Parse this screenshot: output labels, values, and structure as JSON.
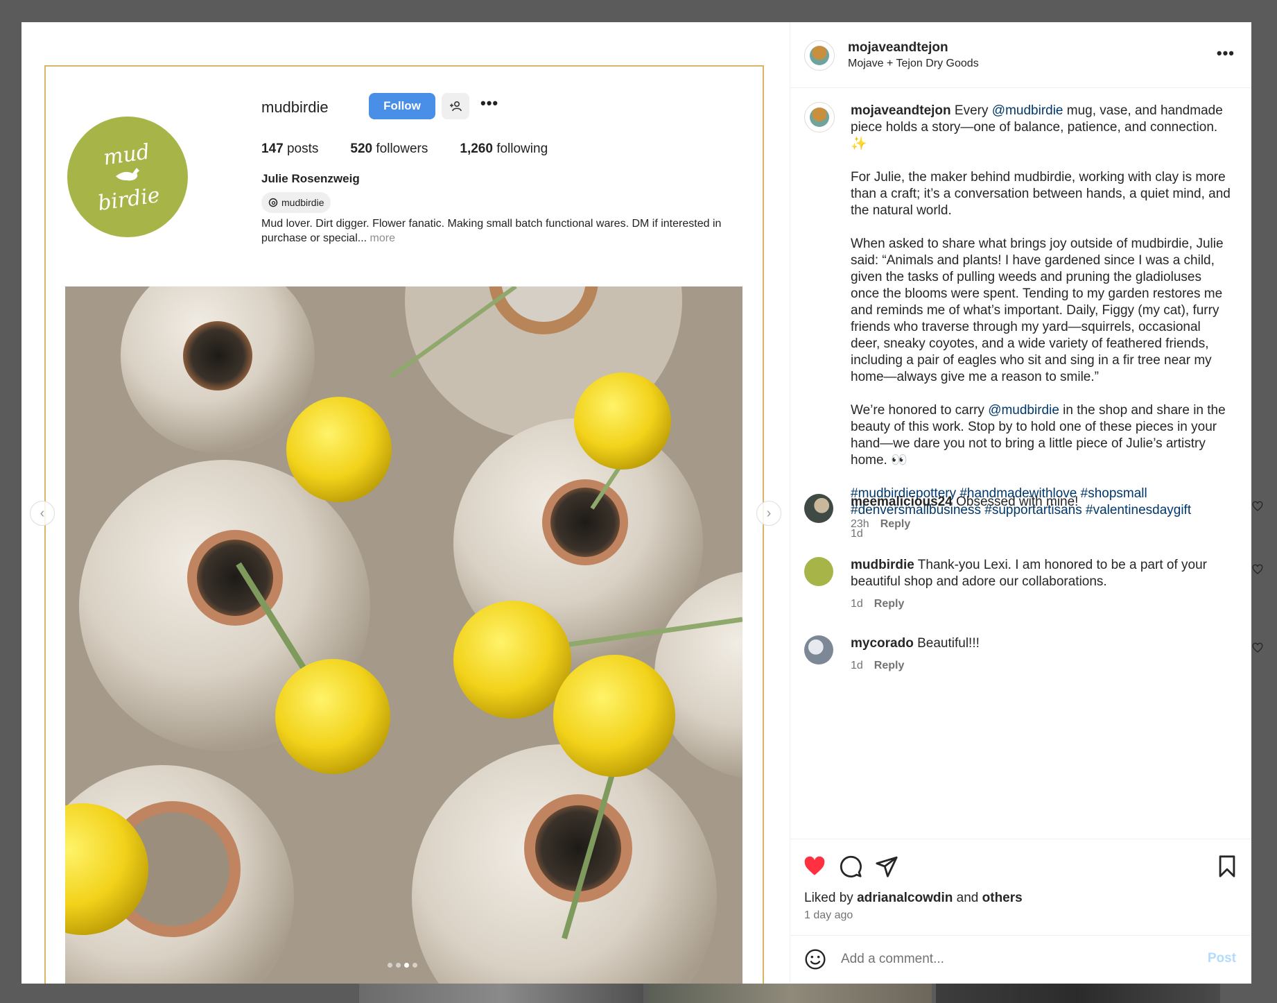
{
  "colors": {
    "accent": "#0095f6",
    "link": "#00376b",
    "heart": "#ff3040",
    "muted": "#737373",
    "post_disabled": "#b3dbff",
    "profile_green": "#a7b548",
    "follow_blue": "#4a8fe7"
  },
  "profile_shot": {
    "username": "mudbirdie",
    "follow_label": "Follow",
    "avatar_line1": "mud",
    "avatar_line2": "birdie",
    "posts_count": "147",
    "posts_label": "posts",
    "followers_count": "520",
    "followers_label": "followers",
    "following_count": "1,260",
    "following_label": "following",
    "full_name": "Julie Rosenzweig",
    "threads_handle": "mudbirdie",
    "bio": "Mud lover. Dirt digger. Flower fanatic. Making small batch functional wares. DM if interested in purchase or special...",
    "bio_more": "more"
  },
  "carousel": {
    "slide_count": 4,
    "active_index": 2
  },
  "header": {
    "username": "mojaveandtejon",
    "subtitle": "Mojave + Tejon Dry Goods"
  },
  "caption": {
    "username": "mojaveandtejon",
    "p1_pre": " Every ",
    "p1_mention": "@mudbirdie",
    "p1_post": " mug, vase, and handmade piece holds a story—one of balance, patience, and connection. ✨",
    "p2": "For Julie, the maker behind mudbirdie, working with clay is more than a craft; it’s a conversation between hands, a quiet mind, and the natural world.",
    "p3": "When asked to share what brings joy outside of mudbirdie, Julie said: “Animals and plants! I have gardened since I was a child, given the tasks of pulling weeds and pruning the gladioluses once the blooms were spent. Tending to my garden restores me and reminds me of what’s important. Daily, Figgy (my cat), furry friends who traverse through my yard—squirrels, occasional deer, sneaky coyotes, and a wide variety of feathered friends, including a pair of eagles who sit and sing in a fir tree near my home—always give me a reason to smile.”",
    "p4_pre": "We’re honored to carry ",
    "p4_mention": "@mudbirdie",
    "p4_post": " in the shop and share in the beauty of this work. Stop by to hold one of these pieces in your hand—we dare you not to bring a little piece of Julie’s artistry home. 👀",
    "hashtags": "#mudbirdiepottery #handmadewithlove #shopsmall #denversmallbusiness #supportartisans #valentinesdaygift",
    "time": "1d"
  },
  "comments": [
    {
      "username": "meemalicious24",
      "text": "Obsessed with mine!",
      "time": "23h",
      "reply": "Reply"
    },
    {
      "username": "mudbirdie",
      "text": "Thank-you Lexi. I am honored to be a part of your beautiful shop and adore our collaborations.",
      "time": "1d",
      "reply": "Reply"
    },
    {
      "username": "mycorado",
      "text": "Beautiful!!!",
      "time": "1d",
      "reply": "Reply"
    }
  ],
  "likes": {
    "prefix": "Liked by",
    "user": "adrianalcowdin",
    "mid": "and",
    "others": "others",
    "ago": "1 day ago"
  },
  "add_comment": {
    "placeholder": "Add a comment...",
    "post_label": "Post"
  },
  "icons": [
    "more-icon",
    "heart-filled-icon",
    "comment-icon",
    "share-icon",
    "bookmark-icon",
    "emoji-icon",
    "heart-outline-icon",
    "chevron-left-icon",
    "chevron-right-icon",
    "add-user-icon",
    "threads-icon"
  ]
}
